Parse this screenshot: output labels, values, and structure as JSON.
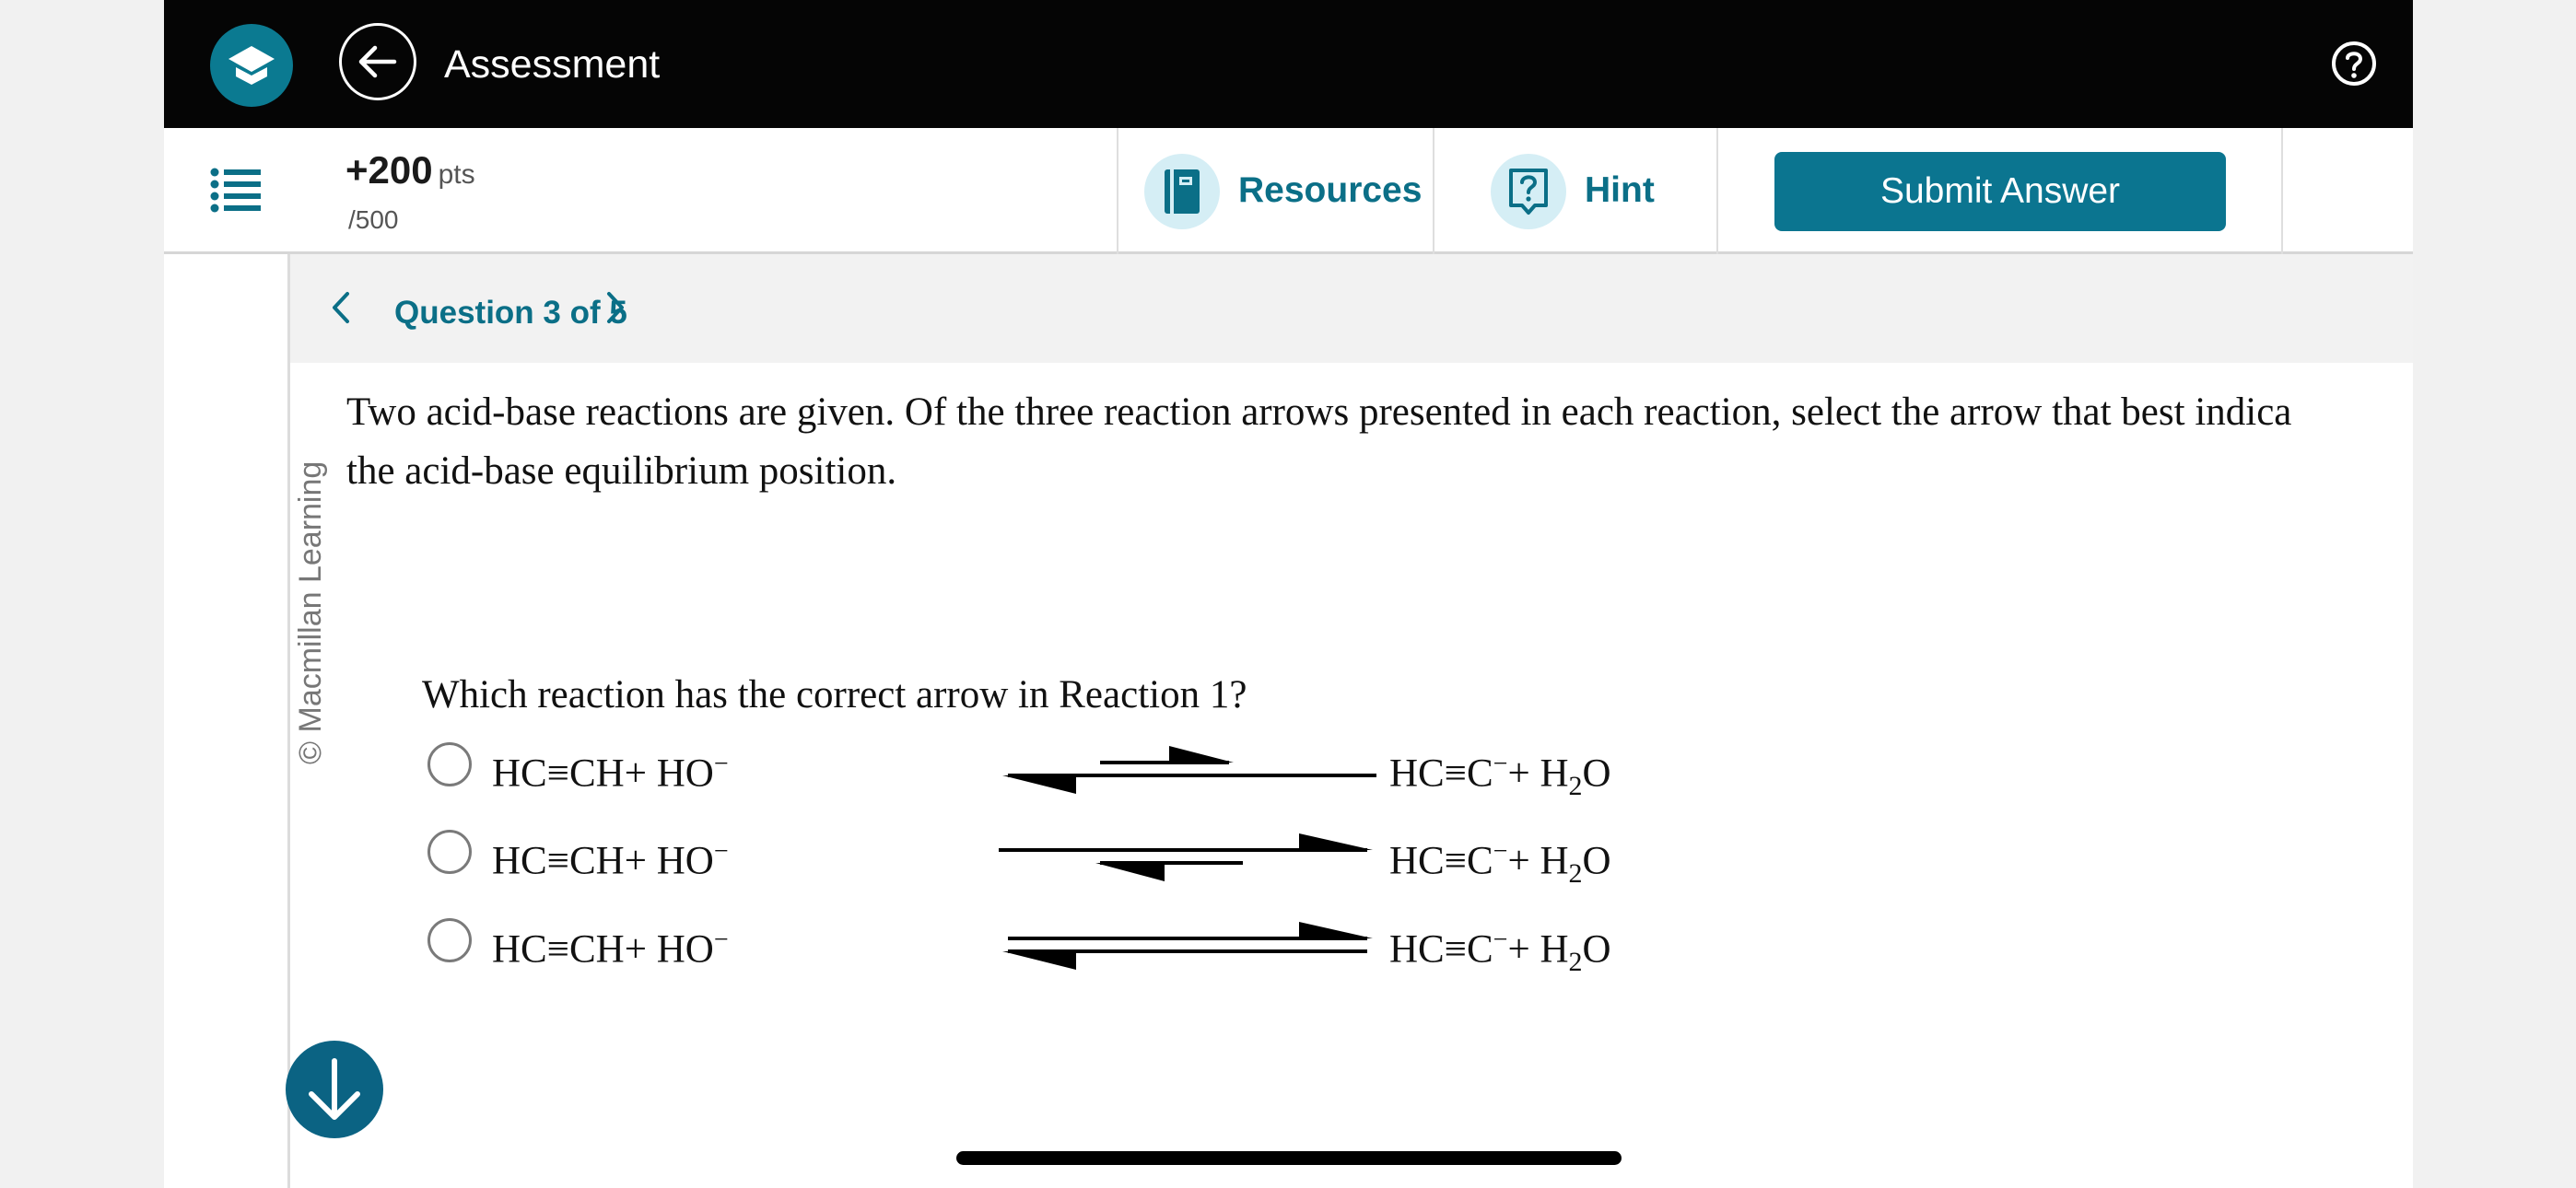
{
  "header": {
    "title": "Assessment"
  },
  "toolbar": {
    "score": "+200",
    "score_unit": "pts",
    "score_total": "/500",
    "resources_label": "Resources",
    "hint_label": "Hint",
    "submit_label": "Submit Answer"
  },
  "nav": {
    "question_label": "Question 3 of 5"
  },
  "sidebar": {
    "copyright": "© Macmillan Learning"
  },
  "question": {
    "prompt_line1": "Two acid-base reactions are given. Of the three reaction arrows presented in each reaction, select the arrow that best indica",
    "prompt_line2": "the acid-base equilibrium position.",
    "subquestion": "Which reaction has the correct arrow in Reaction 1?",
    "options": [
      {
        "reactant": "HC≡CH+ HO",
        "reactant_sup": "−",
        "product_a": "HC≡C",
        "product_sup": "−",
        "product_b": "+ H",
        "product_sub": "2",
        "product_c": "O",
        "arrow": "favor-reverse"
      },
      {
        "reactant": "HC≡CH+ HO",
        "reactant_sup": "−",
        "product_a": "HC≡C",
        "product_sup": "−",
        "product_b": "+ H",
        "product_sub": "2",
        "product_c": "O",
        "arrow": "favor-forward"
      },
      {
        "reactant": "HC≡CH+ HO",
        "reactant_sup": "−",
        "product_a": "HC≡C",
        "product_sup": "−",
        "product_b": "+ H",
        "product_sub": "2",
        "product_c": "O",
        "arrow": "equal"
      }
    ]
  },
  "colors": {
    "accent": "#0b7590",
    "topbar": "#050505"
  }
}
